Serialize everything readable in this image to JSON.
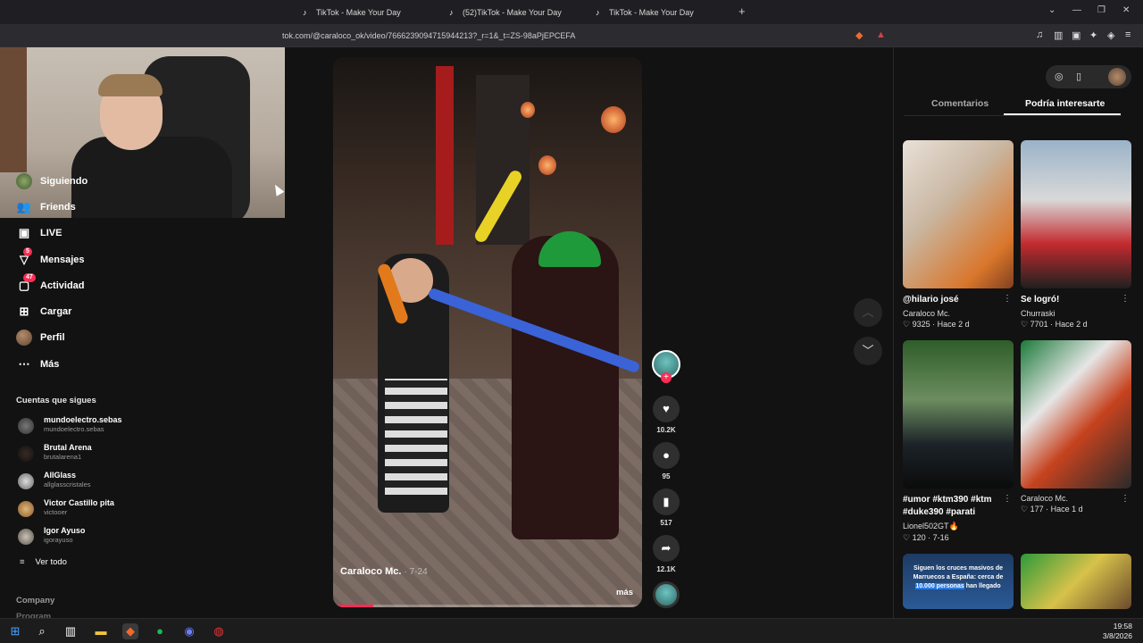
{
  "browser": {
    "tabs": [
      {
        "label": "TikTok - Make Your Day"
      },
      {
        "label": "(52)TikTok - Make Your Day"
      },
      {
        "label": "TikTok - Make Your Day"
      }
    ],
    "new_tab": "+",
    "url": "tok.com/@caraloco_ok/video/7666239094715944213?_r=1&_t=ZS-98aPjEPCEFA"
  },
  "nav": {
    "items": [
      {
        "label": "Siguiendo",
        "icon": "following-avatar"
      },
      {
        "label": "Friends",
        "icon": "friends-icon"
      },
      {
        "label": "LIVE",
        "icon": "live-icon"
      },
      {
        "label": "Mensajes",
        "icon": "messages-icon",
        "badge": "5"
      },
      {
        "label": "Actividad",
        "icon": "activity-icon",
        "badge": "47"
      },
      {
        "label": "Cargar",
        "icon": "upload-icon"
      },
      {
        "label": "Perfil",
        "icon": "profile-avatar"
      },
      {
        "label": "Más",
        "icon": "more-icon"
      }
    ],
    "following_title": "Cuentas que sigues",
    "following": [
      {
        "name": "mundoelectro.sebas",
        "handle": "mundoelectro.sebas"
      },
      {
        "name": "Brutal Arena",
        "handle": "brutalarena1"
      },
      {
        "name": "AllGlass",
        "handle": "allglasscristales"
      },
      {
        "name": "Victor Castillo pita",
        "handle": "victooer"
      },
      {
        "name": "Igor Ayuso",
        "handle": "igorayuso"
      }
    ],
    "see_all": "Ver todo",
    "company": "Company",
    "program": "Program"
  },
  "video": {
    "author": "Caraloco Mc.",
    "date": "· 7-24",
    "more": "más",
    "progress": 0.13
  },
  "actions": {
    "likes": "10.2K",
    "comments": "95",
    "saves": "517",
    "shares": "12.1K"
  },
  "right_panel": {
    "tabs": [
      "Comentarios",
      "Podría interesarte"
    ],
    "active_tab": "Podría interesarte",
    "cards": [
      {
        "title": "@hilario josé",
        "author": "Caraloco Mc.",
        "likes": "9325",
        "when": "Hace 2 d"
      },
      {
        "title": "Se logró!",
        "author": "Churraski",
        "likes": "7701",
        "when": "Hace 2 d"
      },
      {
        "title": "#umor #ktm390 #ktm #duke390 #parati",
        "author": "Lionel502GT🔥",
        "likes": "120",
        "when": "7-16"
      },
      {
        "title": "",
        "author": "Caraloco Mc.",
        "likes": "177",
        "when": "Hace 1 d"
      }
    ],
    "news_text": "Siguen los cruces masivos de Marruecos a España: cerca de",
    "news_highlight": "10.000 personas",
    "news_tail": "han llegado"
  },
  "taskbar": {
    "time": "19:58",
    "date": "3/8/2026"
  },
  "colors": {
    "accent": "#fe2c55",
    "background": "#121212"
  }
}
